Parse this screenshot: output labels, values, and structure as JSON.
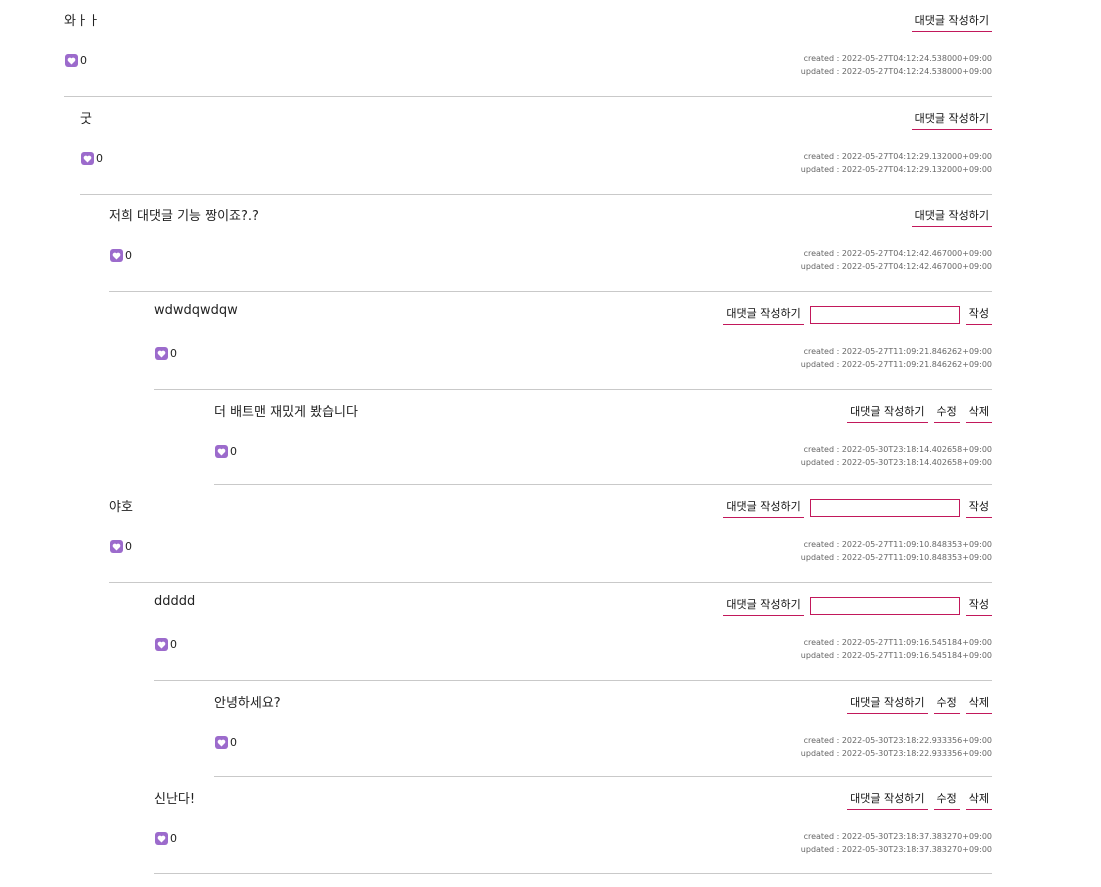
{
  "labels": {
    "reply": "대댓글 작성하기",
    "submit": "작성",
    "edit": "수정",
    "delete": "삭제",
    "created_prefix": "created : ",
    "updated_prefix": "updated : "
  },
  "colors": {
    "accent": "#c2185b",
    "heart": "#9c6bcc",
    "divider": "#c9c9c9"
  },
  "comments": [
    {
      "text": "와ㅏㅏ",
      "likes": "0",
      "created": "2022-05-27T04:12:24.538000+09:00",
      "updated": "2022-05-27T04:12:24.538000+09:00",
      "depth": 0,
      "show_input": false,
      "owner": false
    },
    {
      "text": "굿",
      "likes": "0",
      "created": "2022-05-27T04:12:29.132000+09:00",
      "updated": "2022-05-27T04:12:29.132000+09:00",
      "depth": 1,
      "show_input": false,
      "owner": false
    },
    {
      "text": "저희 대댓글 기능 짱이죠?.?",
      "likes": "0",
      "created": "2022-05-27T04:12:42.467000+09:00",
      "updated": "2022-05-27T04:12:42.467000+09:00",
      "depth": 2,
      "show_input": false,
      "owner": false
    },
    {
      "text": "wdwdqwdqw",
      "likes": "0",
      "created": "2022-05-27T11:09:21.846262+09:00",
      "updated": "2022-05-27T11:09:21.846262+09:00",
      "depth": 3,
      "show_input": true,
      "owner": false
    },
    {
      "text": "더 배트맨 재밌게 봤습니다",
      "likes": "0",
      "created": "2022-05-30T23:18:14.402658+09:00",
      "updated": "2022-05-30T23:18:14.402658+09:00",
      "depth": 4,
      "show_input": false,
      "owner": true
    },
    {
      "text": "야호",
      "likes": "0",
      "created": "2022-05-27T11:09:10.848353+09:00",
      "updated": "2022-05-27T11:09:10.848353+09:00",
      "depth": 2,
      "show_input": true,
      "owner": false
    },
    {
      "text": "ddddd",
      "likes": "0",
      "created": "2022-05-27T11:09:16.545184+09:00",
      "updated": "2022-05-27T11:09:16.545184+09:00",
      "depth": 3,
      "show_input": true,
      "owner": false
    },
    {
      "text": "안녕하세요?",
      "likes": "0",
      "created": "2022-05-30T23:18:22.933356+09:00",
      "updated": "2022-05-30T23:18:22.933356+09:00",
      "depth": 4,
      "show_input": false,
      "owner": true
    },
    {
      "text": "신난다!",
      "likes": "0",
      "created": "2022-05-30T23:18:37.383270+09:00",
      "updated": "2022-05-30T23:18:37.383270+09:00",
      "depth": 3,
      "show_input": false,
      "owner": true
    }
  ]
}
